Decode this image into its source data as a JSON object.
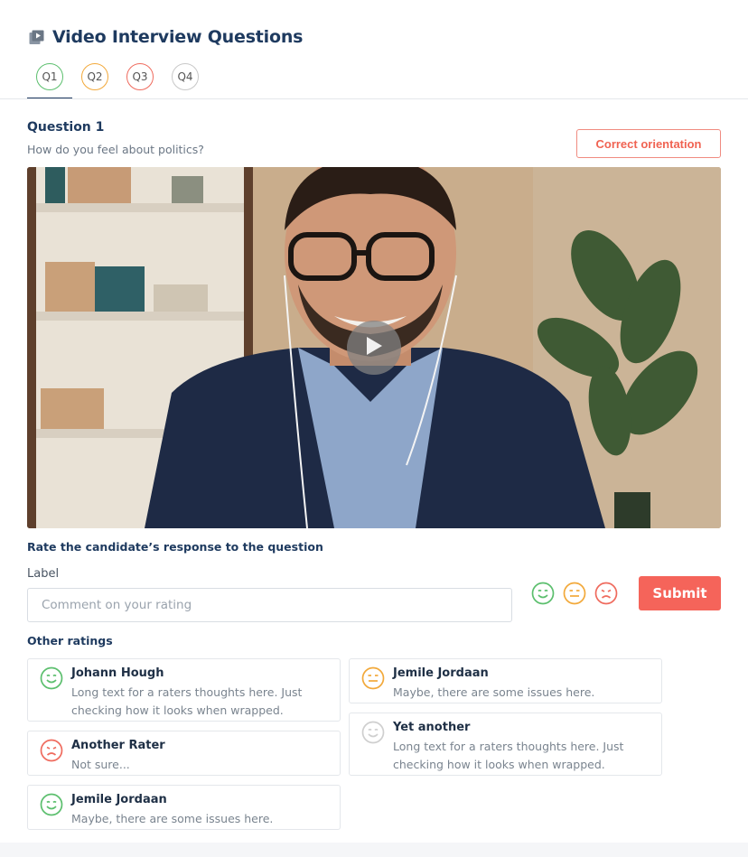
{
  "header": {
    "title": "Video Interview Questions",
    "icon": "video-library-icon"
  },
  "tabs": [
    {
      "label": "Q1",
      "color": "#5cbf6e",
      "active": true
    },
    {
      "label": "Q2",
      "color": "#f2a93b",
      "active": false
    },
    {
      "label": "Q3",
      "color": "#ef6b5e",
      "active": false
    },
    {
      "label": "Q4",
      "color": "#c8c8c8",
      "active": false
    }
  ],
  "question": {
    "title": "Question 1",
    "text": "How do you feel about politics?",
    "orientation_button": "Correct orientation"
  },
  "video": {
    "play_icon": "play-icon"
  },
  "rating": {
    "title": "Rate the candidate’s response to the question",
    "label": "Label",
    "comment_placeholder": "Comment on your rating",
    "submit_label": "Submit",
    "faces": [
      {
        "name": "happy-face-icon",
        "color": "#5cbf6e"
      },
      {
        "name": "neutral-face-icon",
        "color": "#f2a93b"
      },
      {
        "name": "sad-face-icon",
        "color": "#ef6b5e"
      }
    ]
  },
  "other_ratings": {
    "title": "Other ratings",
    "items": [
      {
        "name": "Johann Hough",
        "text": "Long text for a raters thoughts here. Just checking how it looks when wrapped.",
        "mood": "happy",
        "color": "#5cbf6e"
      },
      {
        "name": "Another Rater",
        "text": "Not sure...",
        "mood": "sad",
        "color": "#ef6b5e"
      },
      {
        "name": "Jemile Jordaan",
        "text": "Maybe, there are some issues here.",
        "mood": "happy",
        "color": "#5cbf6e"
      },
      {
        "name": "Jemile Jordaan",
        "text": "Maybe, there are some issues here.",
        "mood": "neutral",
        "color": "#f2a93b"
      },
      {
        "name": "Yet another",
        "text": "Long text for a raters thoughts here. Just checking how it looks when wrapped.",
        "mood": "happy",
        "color": "#cfcfcf"
      }
    ]
  },
  "colors": {
    "accent": "#1e3a5f",
    "submit": "#f5645a",
    "orientation": "#f06352"
  }
}
